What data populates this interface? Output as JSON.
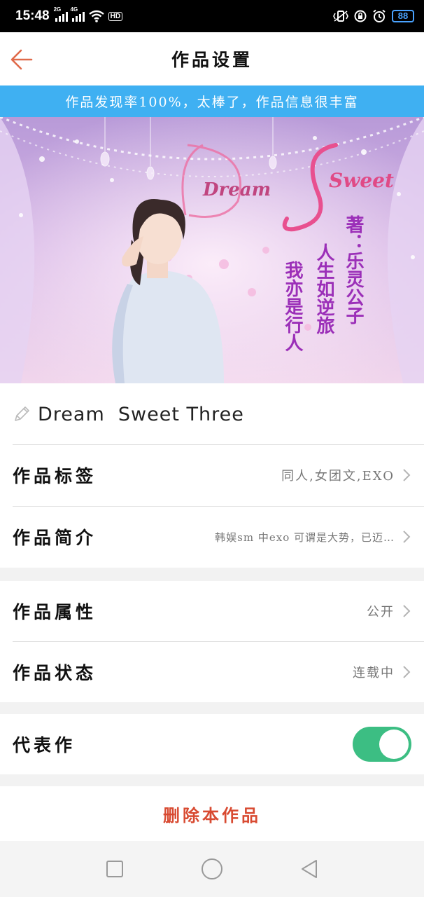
{
  "status_bar": {
    "time": "15:48",
    "signal1": "2G",
    "signal2": "4G",
    "hd": "HD",
    "battery": "88"
  },
  "header": {
    "title": "作品设置"
  },
  "banner": {
    "text": "作品发现率100%，太棒了，作品信息很丰富"
  },
  "cover": {
    "title_left": "Dream",
    "title_right": "Sweet",
    "author": "著：乐灵公子",
    "line1": "人生如逆旅",
    "line2": "我亦是行人"
  },
  "work": {
    "name": "Dream  Sweet Three"
  },
  "rows": {
    "tags": {
      "label": "作品标签",
      "value": "同人,女团文,EXO"
    },
    "intro": {
      "label": "作品简介",
      "value": "韩娱sm 中exo 可谓是大势，已迈…"
    },
    "attribute": {
      "label": "作品属性",
      "value": "公开"
    },
    "status": {
      "label": "作品状态",
      "value": "连载中"
    },
    "representative": {
      "label": "代表作",
      "enabled": true
    }
  },
  "delete_label": "删除本作品",
  "colors": {
    "accent": "#3fb0f2",
    "toggle_on": "#3cbe83",
    "danger": "#d84a31",
    "back_arrow": "#e06a4a"
  }
}
